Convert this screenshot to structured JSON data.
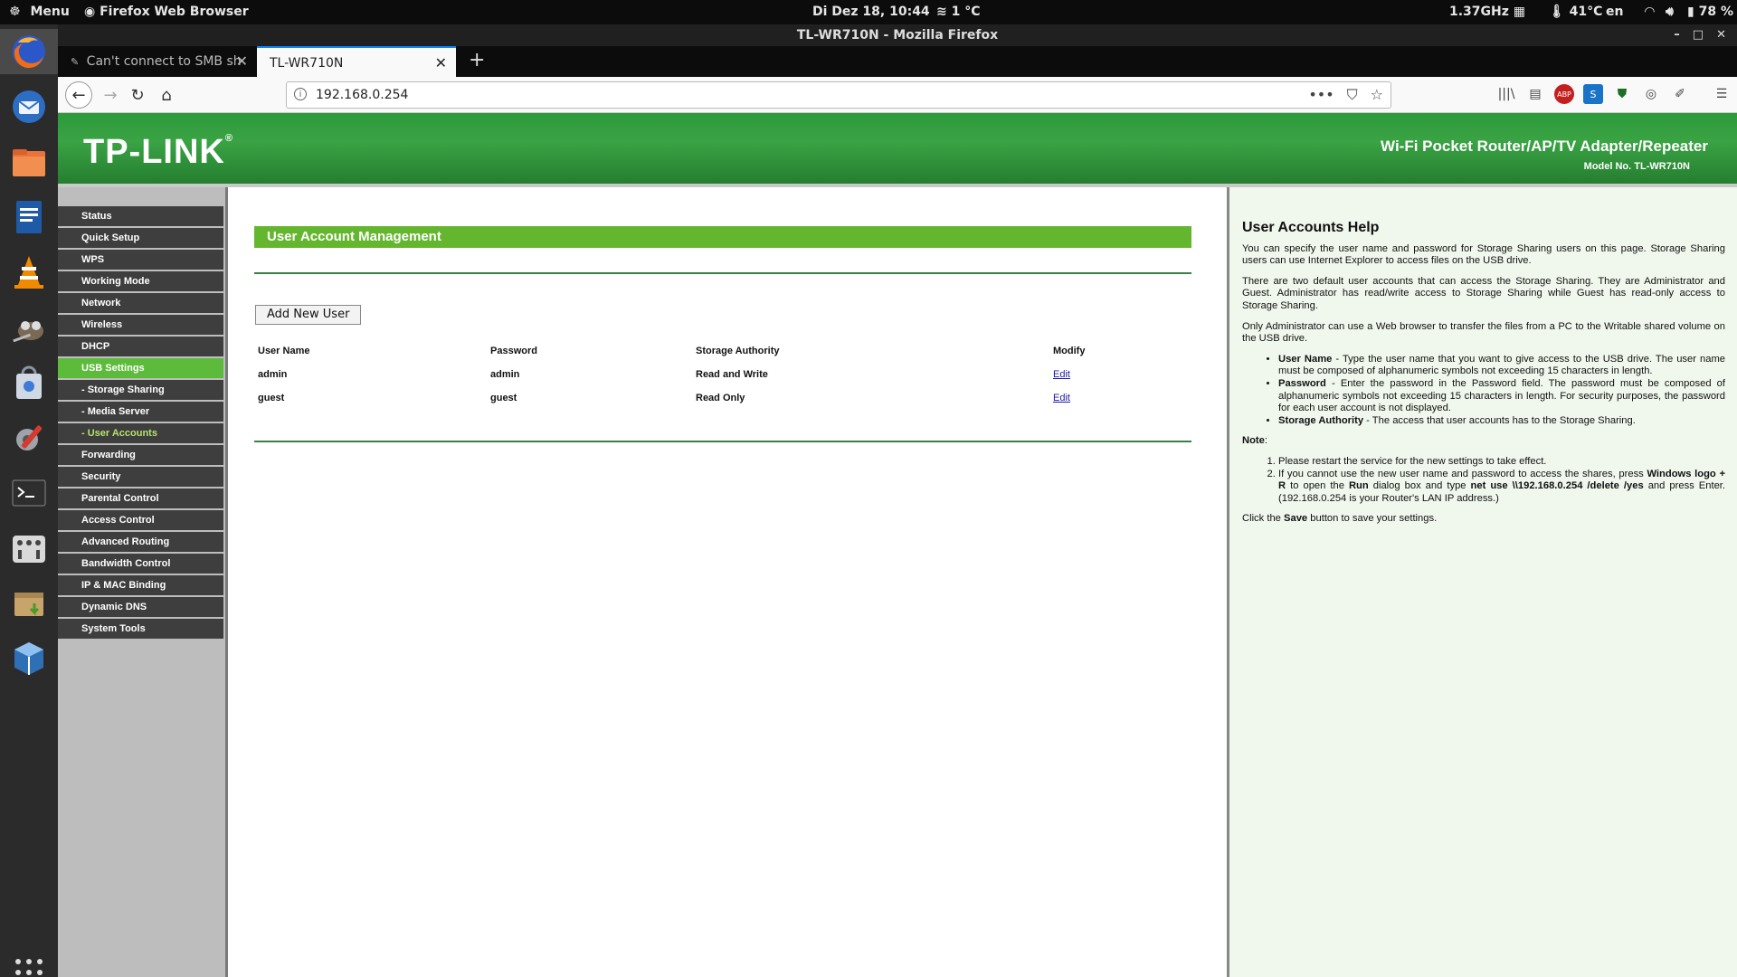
{
  "system_panel": {
    "menu_label": "Menu",
    "active_app": "Firefox Web Browser",
    "clock": "Di Dez 18, 10:44",
    "weather": "1 °C",
    "cpu_freq": "1.37GHz",
    "temperature": "41°C",
    "language": "en",
    "battery": "78 %"
  },
  "dock": {
    "items": [
      "firefox-icon",
      "thunderbird-icon",
      "files-icon",
      "writer-icon",
      "vlc-icon",
      "gimp-icon",
      "software-icon",
      "settings-icon",
      "terminal-icon",
      "mixer-icon",
      "archive-icon",
      "virtualbox-icon"
    ]
  },
  "window": {
    "title": "TL-WR710N - Mozilla Firefox",
    "tabs": [
      {
        "label": "Can't connect to SMB sh"
      },
      {
        "label": "TL-WR710N"
      }
    ],
    "url": "192.168.0.254"
  },
  "tp_header": {
    "logo": "TP-LINK",
    "logo_reg": "®",
    "product": "Wi-Fi Pocket Router/AP/TV Adapter/Repeater",
    "model": "Model No. TL-WR710N"
  },
  "menu": [
    {
      "label": "Status"
    },
    {
      "label": "Quick Setup"
    },
    {
      "label": "WPS"
    },
    {
      "label": "Working Mode"
    },
    {
      "label": "Network"
    },
    {
      "label": "Wireless"
    },
    {
      "label": "DHCP"
    },
    {
      "label": "USB Settings"
    },
    {
      "label": "- Storage Sharing"
    },
    {
      "label": "- Media Server"
    },
    {
      "label": "- User Accounts"
    },
    {
      "label": "Forwarding"
    },
    {
      "label": "Security"
    },
    {
      "label": "Parental Control"
    },
    {
      "label": "Access Control"
    },
    {
      "label": "Advanced Routing"
    },
    {
      "label": "Bandwidth Control"
    },
    {
      "label": "IP & MAC Binding"
    },
    {
      "label": "Dynamic DNS"
    },
    {
      "label": "System Tools"
    }
  ],
  "main": {
    "title": "User Account Management",
    "add_button": "Add New User",
    "columns": [
      "User Name",
      "Password",
      "Storage Authority",
      "Modify"
    ],
    "rows": [
      {
        "user": "admin",
        "password": "admin",
        "authority": "Read and Write",
        "modify": "Edit"
      },
      {
        "user": "guest",
        "password": "guest",
        "authority": "Read Only",
        "modify": "Edit"
      }
    ]
  },
  "help": {
    "title": "User Accounts Help",
    "p1": "You can specify the user name and password for Storage Sharing users on this page. Storage Sharing users can use Internet Explorer to access files on the USB drive.",
    "p2": "There are two default user accounts that can access the Storage Sharing. They are Administrator and Guest. Administrator has read/write access to Storage Sharing while Guest has read-only access to Storage Sharing.",
    "p3": "Only Administrator can use a Web browser to transfer the files from a PC to the Writable shared volume on the USB drive.",
    "bullets": [
      {
        "term": "User Name",
        "text": " - Type the user name that you want to give access to the USB drive. The user name must be composed of alphanumeric symbols not exceeding 15 characters in length."
      },
      {
        "term": "Password",
        "text": " - Enter the password in the Password field. The password must be composed of alphanumeric symbols not exceeding 15 characters in length. For security purposes, the password for each user account is not displayed."
      },
      {
        "term": "Storage Authority",
        "text": " - The access that user accounts has to the Storage Sharing."
      }
    ],
    "note_label": "Note",
    "note_colon": ":",
    "note1": "Please restart the service for the new settings to take effect.",
    "note2_a": "If you cannot use the new user name and password to access the shares, press ",
    "note2_b": "Windows logo + R",
    "note2_c": " to open the ",
    "note2_d": "Run",
    "note2_e": " dialog box and type ",
    "note2_f": "net use \\\\192.168.0.254 /delete /yes",
    "note2_g": " and press Enter. (192.168.0.254 is your Router's LAN IP address.)",
    "save_a": "Click the ",
    "save_b": "Save",
    "save_c": " button to save your settings."
  }
}
